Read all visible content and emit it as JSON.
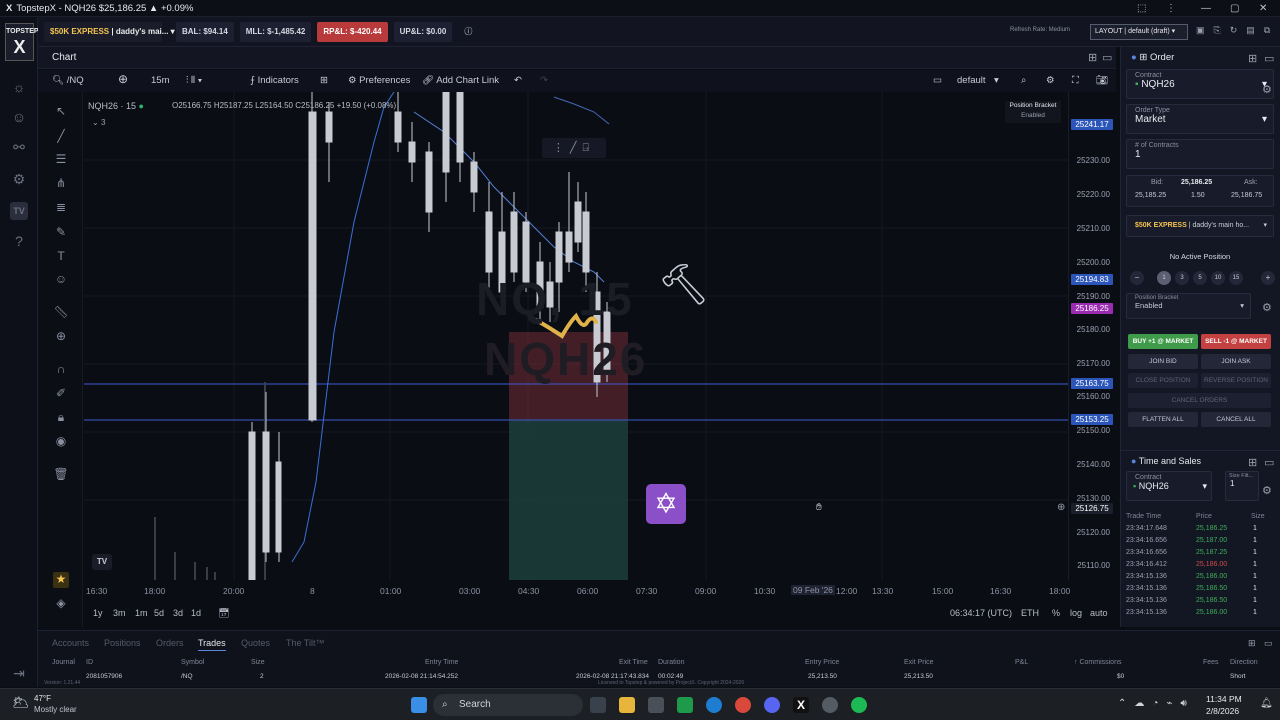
{
  "window": {
    "app": "TopstepX",
    "title": "TopstepX - NQH26 $25,186.25 ▲ +0.09%"
  },
  "topbar": {
    "account": "$50K EXPRESS",
    "account_name": "daddy's mai...",
    "bal": "BAL: $94.14",
    "mll": "MLL: $-1,485.42",
    "rpl": "RP&L: $-420.44",
    "upl": "UP&L: $0.00",
    "refresh": "Refresh Rate: Medium",
    "layout": "LAYOUT | default (draft)"
  },
  "chart": {
    "panel_title": "Chart",
    "symbol_search": "/NQ",
    "interval": "15m",
    "indicators": "Indicators",
    "preferences": "Preferences",
    "add_chart_link": "Add Chart Link",
    "layout_name": "default",
    "legend_symbol": "NQH26 · 15",
    "legend_ohlc": "O25166.75 H25187.25 L25164.50 C25186.25 +19.50 (+0.08%)",
    "legend_count": "3",
    "watermark_1": "NQ, 15",
    "watermark_2": "NQH26",
    "position_bracket_title": "Position Bracket",
    "position_bracket_state": "Enabled",
    "tv_logo": "TV"
  },
  "price_axis": {
    "labels": [
      "25230.00",
      "25220.00",
      "25210.00",
      "25200.00",
      "25190.00",
      "25180.00",
      "25170.00",
      "25160.00",
      "25150.00",
      "25140.00",
      "25130.00",
      "25120.00",
      "25110.00"
    ],
    "tags": [
      {
        "text": "25241.17",
        "color": "#2b55b8"
      },
      {
        "text": "25194.83",
        "color": "#2b55b8"
      },
      {
        "text": "25186.25",
        "color": "#9b2bb0"
      },
      {
        "text": "25163.75",
        "color": "#2b55b8"
      },
      {
        "text": "25153.25",
        "color": "#2b55b8"
      },
      {
        "text": "25126.75",
        "color": "#1b1e2b"
      }
    ]
  },
  "time_axis": {
    "labels": [
      "16:30",
      "18:00",
      "20:00",
      "8",
      "01:00",
      "03:00",
      "04:30",
      "06:00",
      "07:30",
      "09:00",
      "10:30",
      "09 Feb '26",
      "12:00",
      "13:30",
      "15:00",
      "16:30",
      "18:00"
    ]
  },
  "range_bar": {
    "ranges": [
      "1y",
      "3m",
      "1m",
      "5d",
      "3d",
      "1d"
    ],
    "clock": "06:34:17 (UTC)",
    "session": "ETH",
    "pct": "%",
    "log": "log",
    "auto": "auto"
  },
  "order_panel": {
    "title": "Order",
    "contract_label": "Contract",
    "contract": "NQH26",
    "order_type_label": "Order Type",
    "order_type": "Market",
    "contracts_label": "# of Contracts",
    "contracts": "1",
    "bid_label": "Bid:",
    "bid": "25,185.25",
    "last": "25,186.25",
    "spread": "1.50",
    "ask_label": "Ask:",
    "ask": "25,186.75",
    "account_line_y": "$50K EXPRESS",
    "account_line": "daddy's main ho...",
    "no_position": "No Active Position",
    "qty_buttons": [
      "1",
      "3",
      "5",
      "10",
      "15"
    ],
    "bracket_label": "Position Bracket",
    "bracket_value": "Enabled",
    "buy": "BUY +1 @ MARKET",
    "sell": "SELL -1 @ MARKET",
    "join_bid": "JOIN BID",
    "join_ask": "JOIN ASK",
    "close_position": "CLOSE POSITION",
    "reverse_position": "REVERSE POSITION",
    "cancel_orders": "CANCEL ORDERS",
    "flatten_all": "FLATTEN ALL",
    "cancel_all": "CANCEL ALL"
  },
  "time_sales": {
    "title": "Time and Sales",
    "contract_label": "Contract",
    "contract": "NQH26",
    "size_filter_label": "Size Filt...",
    "size_filter": "1",
    "headers": [
      "Trade Time",
      "Price",
      "Size"
    ],
    "rows": [
      {
        "time": "23:34:17.648",
        "price": "25,186.25",
        "size": "1",
        "color": "#3fae5a"
      },
      {
        "time": "23:34:16.656",
        "price": "25,187.00",
        "size": "1",
        "color": "#3fae5a"
      },
      {
        "time": "23:34:16.656",
        "price": "25,187.25",
        "size": "1",
        "color": "#3fae5a"
      },
      {
        "time": "23:34:16.412",
        "price": "25,186.00",
        "size": "1",
        "color": "#d24a4a"
      },
      {
        "time": "23:34:15.136",
        "price": "25,186.00",
        "size": "1",
        "color": "#3fae5a"
      },
      {
        "time": "23:34:15.136",
        "price": "25,186.50",
        "size": "1",
        "color": "#3fae5a"
      },
      {
        "time": "23:34:15.136",
        "price": "25,186.50",
        "size": "1",
        "color": "#3fae5a"
      },
      {
        "time": "23:34:15.136",
        "price": "25,186.00",
        "size": "1",
        "color": "#3fae5a"
      }
    ]
  },
  "bottom_tabs": [
    "Accounts",
    "Positions",
    "Orders",
    "Trades",
    "Quotes",
    "The Tilt™"
  ],
  "bottom_active": "Trades",
  "trades_headers": [
    "Journal",
    "ID",
    "Symbol",
    "Size",
    "Entry Time",
    "Exit Time",
    "Duration",
    "Entry Price",
    "Exit Price",
    "P&L",
    "Commissions",
    "Fees",
    "Direction"
  ],
  "trades_row": [
    "2081057906",
    "/NQ",
    "2",
    "2026-02-08 21:14:54.252",
    "2026-02-08 21:17:43.834",
    "00:02:49",
    "25,213.50",
    "25,213.50",
    "",
    "$0",
    "",
    "Short"
  ],
  "footer_version": "Version: 1.21.44",
  "footer_license": "Licensed to Topstep & powered by ProjectX. Copyright 2024-2026",
  "taskbar": {
    "weather_temp": "47°F",
    "weather_desc": "Mostly clear",
    "search": "Search",
    "time": "11:34 PM",
    "date": "2/8/2026"
  }
}
